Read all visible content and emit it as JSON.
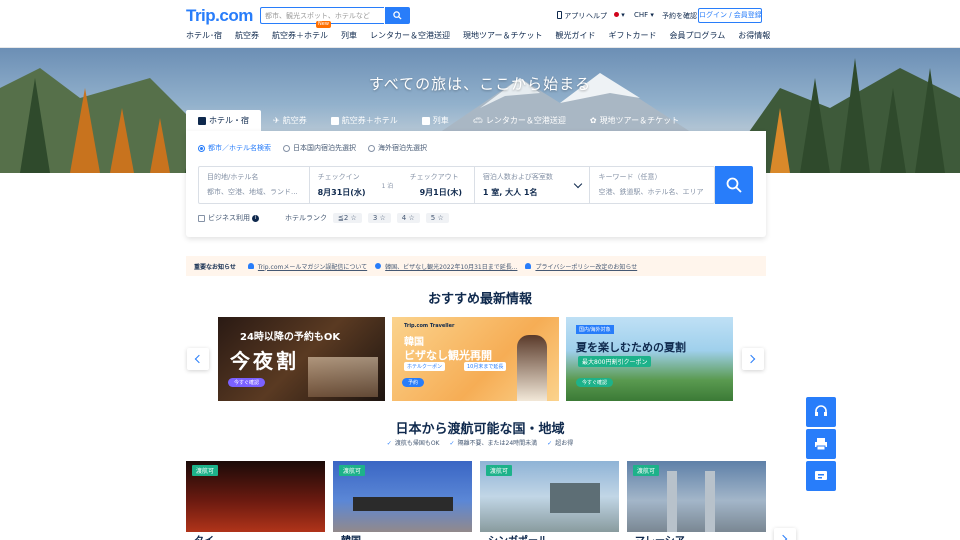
{
  "header": {
    "logo": "Trip.com",
    "search_placeholder": "都市、観光スポット、ホテルなど",
    "app": "アプリ",
    "help": "ヘルプ",
    "currency": "CHF",
    "booking_check": "予約を確認",
    "login": "ログイン / 会員登録"
  },
  "nav": {
    "items": [
      "ホテル･宿",
      "航空券",
      "航空券＋ホテル",
      "列車",
      "レンタカー＆空港送迎",
      "現地ツアー＆チケット",
      "観光ガイド",
      "ギフトカード",
      "会員プログラム",
      "お得情報"
    ],
    "new_badge": "New"
  },
  "hero": {
    "title": "すべての旅は、ここから始まる"
  },
  "tabs": [
    "ホテル・宿",
    "航空券",
    "航空券＋ホテル",
    "列車",
    "レンタカー＆空港送迎",
    "現地ツアー＆チケット"
  ],
  "search": {
    "radios": [
      "都市／ホテル名検索",
      "日本国内宿泊先選択",
      "海外宿泊先選択"
    ],
    "destination_label": "目的地/ホテル名",
    "destination_placeholder": "都市、空港、地域、ランド...",
    "checkin_label": "チェックイン",
    "checkin_value": "8月31日(水)",
    "nights": "1 泊",
    "checkout_label": "チェックアウト",
    "checkout_value": "9月1日(木)",
    "guests_label": "宿泊人数および客室数",
    "guests_value": "1 室, 大人 1名",
    "keyword_label": "キーワード（任意）",
    "keyword_placeholder": "空港、鉄道駅、ホテル名、エリア",
    "business": "ビジネス利用",
    "rank_label": "ホテルランク",
    "ranks": [
      "≦2 ☆",
      "3 ☆",
      "4 ☆",
      "5 ☆"
    ]
  },
  "notice": {
    "label": "重要なお知らせ",
    "items": [
      "Trip.comメールマガジン誤配信について",
      "韓国、ビザなし観光2022年10月31日まで延長...",
      "プライバシーポリシー改定のお知らせ"
    ]
  },
  "recommend": {
    "title": "おすすめ最新情報",
    "promos": [
      {
        "head": "24時以降の予約もOK",
        "big": "今夜割",
        "chip": "今すぐ確認"
      },
      {
        "brand": "Trip.com Traveller",
        "head": "韓国",
        "big": "ビザなし観光再開",
        "coupon": "ホテルクーポン",
        "extend": "10月末まで延長",
        "chip": "予約"
      },
      {
        "tag": "国内/海外対象",
        "big": "夏を楽しむための夏割",
        "coupon": "最大800円割引クーポン",
        "chip": "今すぐ確認"
      }
    ]
  },
  "destinations": {
    "title": "日本から渡航可能な国・地域",
    "perks": [
      "渡航も帰国もOK",
      "隔離不要、または24時間未満",
      "超お得"
    ],
    "badge": "渡航可",
    "items": [
      "タイ",
      "韓国",
      "シンガポール",
      "マレーシア"
    ]
  }
}
